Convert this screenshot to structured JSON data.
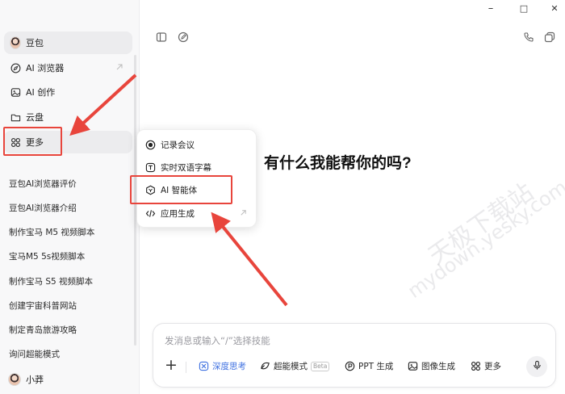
{
  "window": {
    "minimize": "–",
    "maximize": "□",
    "close": "✕"
  },
  "sidebar": {
    "app_name": "豆包",
    "items": [
      {
        "label": "AI 浏览器",
        "icon": "compass-icon",
        "external": true
      },
      {
        "label": "AI 创作",
        "icon": "image-icon",
        "external": false
      },
      {
        "label": "云盘",
        "icon": "folder-icon",
        "external": false
      },
      {
        "label": "更多",
        "icon": "grid-icon",
        "external": false
      }
    ],
    "history": [
      "豆包AI浏览器评价",
      "豆包AI浏览器介绍",
      "制作宝马 M5 视频脚本",
      "宝马M5 5s视频脚本",
      "制作宝马 S5 视频脚本",
      "创建宇宙科普网站",
      "制定青岛旅游攻略",
      "询问超能模式"
    ],
    "user_name": "小莽"
  },
  "more_menu": {
    "items": [
      {
        "label": "记录会议",
        "icon": "record-icon"
      },
      {
        "label": "实时双语字幕",
        "icon": "text-box-icon"
      },
      {
        "label": "AI 智能体",
        "icon": "agent-icon"
      },
      {
        "label": "应用生成",
        "icon": "code-icon",
        "external": true
      }
    ]
  },
  "main": {
    "greeting": "有什么我能帮你的吗?",
    "input": {
      "placeholder": "发消息或输入“/”选择技能",
      "tools": [
        {
          "label": "深度思考",
          "icon": "deep-think-icon",
          "active": true
        },
        {
          "label": "超能模式",
          "icon": "super-mode-icon",
          "badge": "Beta"
        },
        {
          "label": "PPT 生成",
          "icon": "ppt-icon"
        },
        {
          "label": "图像生成",
          "icon": "image-icon"
        },
        {
          "label": "更多",
          "icon": "grid-icon"
        }
      ]
    }
  },
  "watermark": {
    "line1": "天极下载站",
    "line2": "mydown.yesky.com"
  },
  "colors": {
    "accent_blue": "#3d6fe0",
    "annotation_red": "#e8453c"
  }
}
